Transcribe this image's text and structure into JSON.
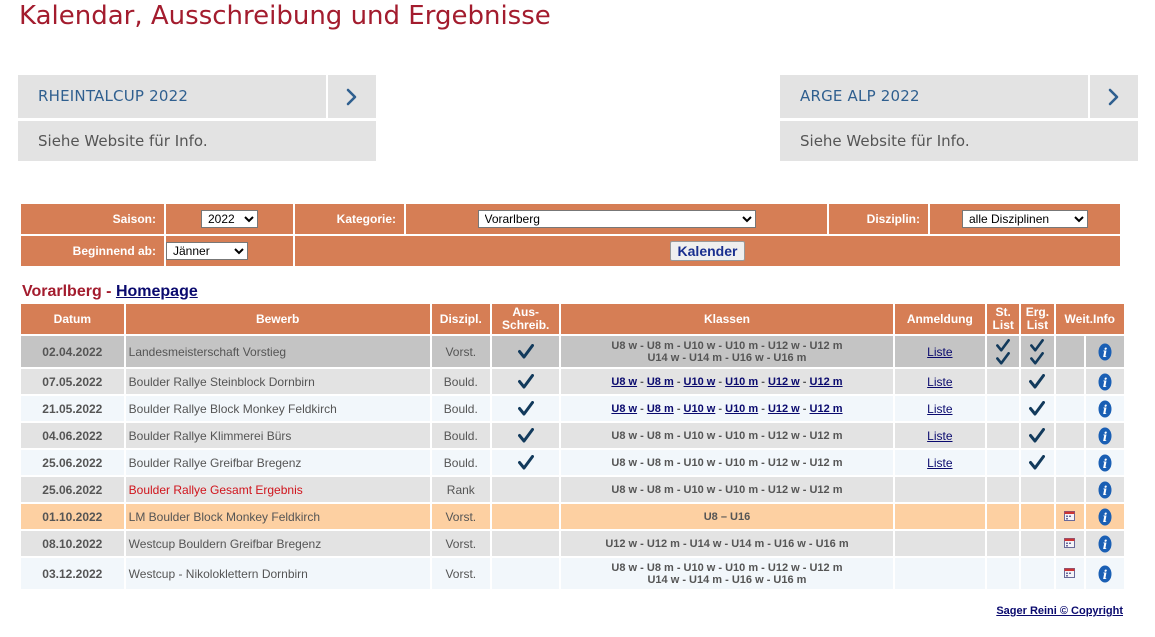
{
  "page": {
    "title": "Kalendar, Ausschreibung und Ergebnisse"
  },
  "cups": [
    {
      "title": "RHEINTALCUP 2022",
      "info": "Siehe Website für Info.",
      "arrow_icon": "chevron-right-icon"
    },
    {
      "title": "ARGE ALP 2022",
      "info": "Siehe Website für Info.",
      "arrow_icon": "chevron-right-icon"
    }
  ],
  "filter": {
    "saison_label": "Saison:",
    "saison_value": "2022",
    "kategorie_label": "Kategorie:",
    "kategorie_value": "Vorarlberg",
    "disziplin_label": "Disziplin:",
    "disziplin_value": "alle Disziplinen",
    "beginnend_label": "Beginnend ab:",
    "beginnend_value": "Jänner",
    "button_label": "Kalender"
  },
  "section": {
    "prefix": "Vorarlberg - ",
    "link": "Homepage"
  },
  "table": {
    "headers": {
      "datum": "Datum",
      "bewerb": "Bewerb",
      "diszipl": "Diszipl.",
      "ausschreib_1": "Aus-",
      "ausschreib_2": "Schreib.",
      "klassen": "Klassen",
      "anmeldung": "Anmeldung",
      "stlist_1": "St.",
      "stlist_2": "List",
      "erglist_1": "Erg.",
      "erglist_2": "List",
      "weitinfo": "Weit.Info"
    },
    "rows": [
      {
        "date": "02.04.2022",
        "name": "Landesmeisterschaft Vorstieg",
        "disc": "Vorst.",
        "klassen_1": "U8 w - U8 m - U10 w - U10 m - U12 w - U12 m",
        "klassen_2": "U14 w - U14 m - U16 w - U16 m",
        "anmeldung": "Liste"
      },
      {
        "date": "07.05.2022",
        "name": "Boulder Rallye Steinblock Dornbirn",
        "disc": "Bould.",
        "k1": "U8 w",
        "k2": "U8 m",
        "k3": "U10 w",
        "k4": "U10 m",
        "k5": "U12 w",
        "k6": "U12 m",
        "sep": " - ",
        "anmeldung": "Liste"
      },
      {
        "date": "21.05.2022",
        "name": "Boulder Rallye Block Monkey Feldkirch",
        "disc": "Bould.",
        "k1": "U8 w",
        "k2": "U8 m",
        "k3": "U10 w",
        "k4": "U10 m",
        "k5": "U12 w",
        "k6": "U12 m",
        "anmeldung": "Liste"
      },
      {
        "date": "04.06.2022",
        "name": "Boulder Rallye Klimmerei Bürs",
        "disc": "Bould.",
        "klassen": "U8 w - U8 m - U10 w - U10 m - U12 w - U12 m",
        "anmeldung": "Liste"
      },
      {
        "date": "25.06.2022",
        "name": "Boulder Rallye Greifbar Bregenz",
        "disc": "Bould.",
        "klassen": "U8 w - U8 m - U10 w - U10 m - U12 w - U12 m",
        "anmeldung": "Liste"
      },
      {
        "date": "25.06.2022",
        "name": "Boulder Rallye Gesamt Ergebnis",
        "disc": "Rank",
        "klassen": "U8 w - U8 m - U10 w - U10 m - U12 w - U12 m"
      },
      {
        "date": "01.10.2022",
        "name": "LM Boulder Block Monkey Feldkirch",
        "disc": "Vorst.",
        "klassen": "U8 – U16"
      },
      {
        "date": "08.10.2022",
        "name": "Westcup Bouldern Greifbar Bregenz",
        "disc": "Vorst.",
        "klassen": "U12 w - U12 m - U14 w - U14 m - U16 w - U16 m"
      },
      {
        "date": "03.12.2022",
        "name": "Westcup - Nikoloklettern Dornbirn",
        "disc": "Vorst.",
        "klassen_1": "U8 w - U8 m - U10 w - U10 m - U12 w - U12 m",
        "klassen_2": "U14 w - U14 m - U16 w - U16 m"
      }
    ]
  },
  "footer": {
    "copyright": "Sager Reini © Copyright"
  },
  "colors": {
    "accent": "#d67e55",
    "title": "#a31c2e",
    "cup_title": "#2f5f8f",
    "link": "#0a0a6e",
    "check": "#123a5c",
    "info": "#1a5fb4"
  }
}
